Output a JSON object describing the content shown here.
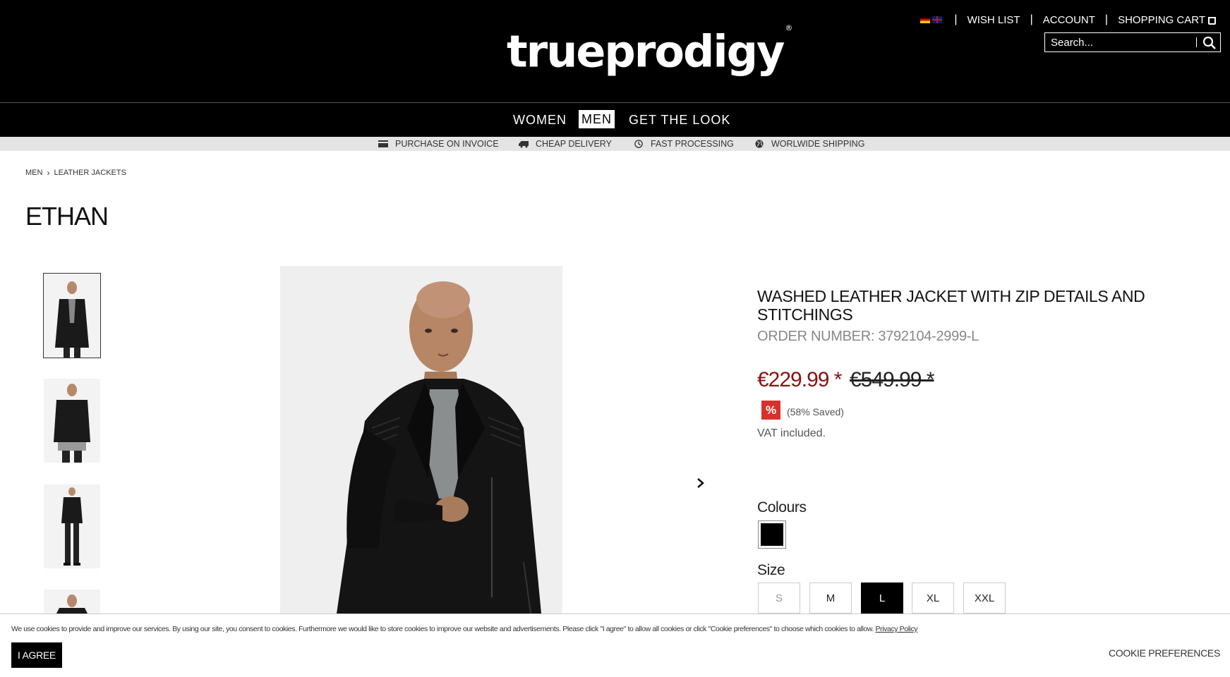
{
  "header": {
    "logo_text": "trueprodigy",
    "logo_mark": "®",
    "wish_list": "WISH LIST",
    "account": "ACCOUNT",
    "shopping_cart": "SHOPPING CART",
    "separator": "|",
    "search_placeholder": "Search..."
  },
  "nav": {
    "items": [
      {
        "label": "WOMEN"
      },
      {
        "label": "MEN",
        "active": true
      },
      {
        "label": "GET THE LOOK"
      }
    ]
  },
  "usp": {
    "items": [
      {
        "label": "PURCHASE ON INVOICE",
        "icon": "wallet-icon"
      },
      {
        "label": "CHEAP DELIVERY",
        "icon": "truck-icon"
      },
      {
        "label": "FAST PROCESSING",
        "icon": "clock-icon"
      },
      {
        "label": "WORLWIDE SHIPPING",
        "icon": "globe-icon"
      }
    ]
  },
  "breadcrumb": {
    "items": [
      "MEN",
      "LEATHER JACKETS"
    ],
    "separator": "›"
  },
  "page_title": "ETHAN",
  "product": {
    "name": "WASHED LEATHER JACKET WITH ZIP DETAILS AND STITCHINGS",
    "order_number": "ORDER NUMBER: 3792104-2999-L",
    "price": "€229.99 *",
    "old_price": "€549.99 *",
    "discount_badge": "%",
    "saved": "(58% Saved)",
    "vat": "VAT included.",
    "colours_label": "Colours",
    "size_label": "Size",
    "sizes": [
      {
        "label": "S",
        "state": "disabled"
      },
      {
        "label": "M",
        "state": "available"
      },
      {
        "label": "L",
        "state": "selected"
      },
      {
        "label": "XL",
        "state": "available"
      },
      {
        "label": "XXL",
        "state": "available"
      }
    ],
    "colour_selected": "#000000",
    "price_color": "#8b1010"
  },
  "cookie": {
    "text": "We use cookies to provide and improve our services. By using our site, you consent to cookies. Furthermore we would like to store cookies to improve our website and advertisements. Please click \"I agree\" to allow all cookies or click \"Cookie preferences\" to choose which cookies to allow.",
    "privacy_link": "Privacy Policy",
    "agree_button": "I AGREE",
    "preferences": "COOKIE PREFERENCES"
  }
}
